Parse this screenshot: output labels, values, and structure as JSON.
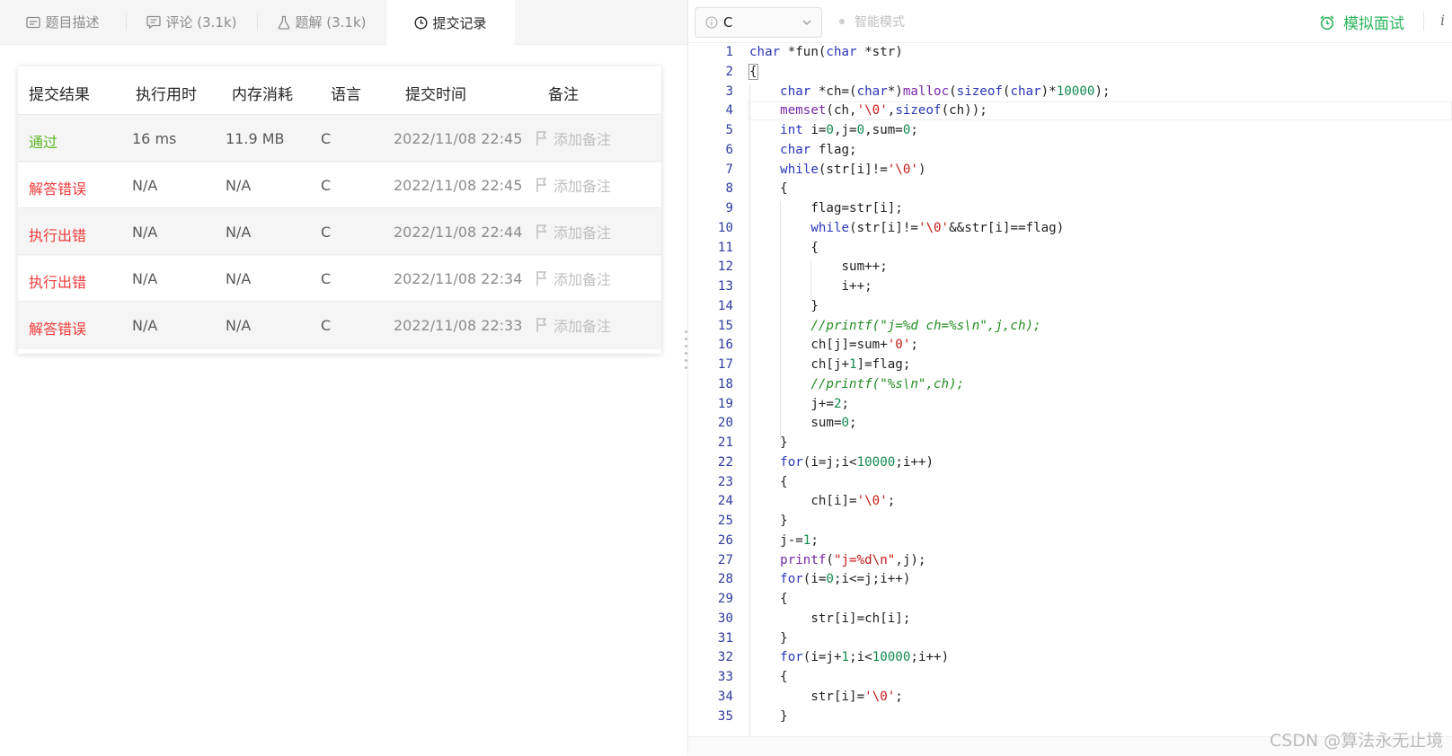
{
  "tabs": [
    {
      "label": "题目描述",
      "icon": "description-icon"
    },
    {
      "label": "评论 (3.1k)",
      "icon": "comment-icon"
    },
    {
      "label": "题解 (3.1k)",
      "icon": "flask-icon"
    },
    {
      "label": "提交记录",
      "icon": "clock-icon"
    }
  ],
  "submissions": {
    "headers": [
      "提交结果",
      "执行用时",
      "内存消耗",
      "语言",
      "提交时间",
      "备注"
    ],
    "rows": [
      {
        "result": "通过",
        "status": "pass",
        "runtime": "16 ms",
        "memory": "11.9 MB",
        "language": "C",
        "time": "2022/11/08 22:45",
        "note": "添加备注"
      },
      {
        "result": "解答错误",
        "status": "fail",
        "runtime": "N/A",
        "memory": "N/A",
        "language": "C",
        "time": "2022/11/08 22:45",
        "note": "添加备注"
      },
      {
        "result": "执行出错",
        "status": "fail",
        "runtime": "N/A",
        "memory": "N/A",
        "language": "C",
        "time": "2022/11/08 22:44",
        "note": "添加备注"
      },
      {
        "result": "执行出错",
        "status": "fail",
        "runtime": "N/A",
        "memory": "N/A",
        "language": "C",
        "time": "2022/11/08 22:34",
        "note": "添加备注"
      },
      {
        "result": "解答错误",
        "status": "fail",
        "runtime": "N/A",
        "memory": "N/A",
        "language": "C",
        "time": "2022/11/08 22:33",
        "note": "添加备注"
      }
    ]
  },
  "toolbar": {
    "language": "C",
    "smart_mode": "智能模式",
    "mock_interview": "模拟面试",
    "more": "i"
  },
  "editor": {
    "lines": [
      "char *fun(char *str)",
      "{",
      "    char *ch=(char*)malloc(sizeof(char)*10000);",
      "    memset(ch,'\\0',sizeof(ch));",
      "    int i=0,j=0,sum=0;",
      "    char flag;",
      "    while(str[i]!='\\0')",
      "    {",
      "        flag=str[i];",
      "        while(str[i]!='\\0'&&str[i]==flag)",
      "        {",
      "            sum++;",
      "            i++;",
      "        }",
      "        //printf(\"j=%d ch=%s\\n\",j,ch);",
      "        ch[j]=sum+'0';",
      "        ch[j+1]=flag;",
      "        //printf(\"%s\\n\",ch);",
      "        j+=2;",
      "        sum=0;",
      "    }",
      "    for(i=j;i<10000;i++)",
      "    {",
      "        ch[i]='\\0';",
      "    }",
      "    j-=1;",
      "    printf(\"j=%d\\n\",j);",
      "    for(i=0;i<=j;i++)",
      "    {",
      "        str[i]=ch[i];",
      "    }",
      "    for(i=j+1;i<10000;i++)",
      "    {",
      "        str[i]='\\0';",
      "    }"
    ],
    "current_line": 4
  },
  "bottom_bar": "",
  "watermark": "CSDN @算法永无止境",
  "colors": {
    "pass": "#5ab726",
    "fail": "#f03b3b",
    "accent": "#2db55d"
  }
}
